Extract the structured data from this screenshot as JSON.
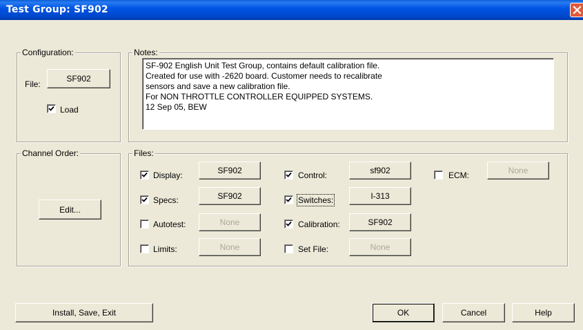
{
  "window": {
    "title": "Test Group:  SF902"
  },
  "configuration": {
    "group_label": "Configuration:",
    "file_label": "File:",
    "file_button": "SF902",
    "load": {
      "label": "Load",
      "checked": true
    }
  },
  "notes": {
    "group_label": "Notes:",
    "text": "SF-902 English Unit Test Group, contains default calibration file.\nCreated for use with -2620 board.  Customer needs to recalibrate\nsensors and save a new calibration file.\nFor NON THROTTLE CONTROLLER EQUIPPED SYSTEMS.\n12 Sep 05, BEW"
  },
  "channel_order": {
    "group_label": "Channel Order:",
    "edit_button": "Edit..."
  },
  "files": {
    "group_label": "Files:",
    "display": {
      "label": "Display:",
      "checked": true,
      "value": "SF902",
      "enabled": true
    },
    "specs": {
      "label": "Specs:",
      "checked": true,
      "value": "SF902",
      "enabled": true
    },
    "autotest": {
      "label": "Autotest:",
      "checked": false,
      "value": "None",
      "enabled": false
    },
    "limits": {
      "label": "Limits:",
      "checked": false,
      "value": "None",
      "enabled": false
    },
    "control": {
      "label": "Control:",
      "checked": true,
      "value": "sf902",
      "enabled": true
    },
    "switches": {
      "label": "Switches:",
      "checked": true,
      "value": "I-313",
      "enabled": true
    },
    "calibration": {
      "label": "Calibration:",
      "checked": true,
      "value": "SF902",
      "enabled": true
    },
    "set_file": {
      "label": "Set File:",
      "checked": false,
      "value": "None",
      "enabled": false
    },
    "ecm": {
      "label": "ECM:",
      "checked": false,
      "value": "None",
      "enabled": false
    }
  },
  "buttons": {
    "install": "Install, Save, Exit",
    "ok": "OK",
    "cancel": "Cancel",
    "help": "Help"
  }
}
